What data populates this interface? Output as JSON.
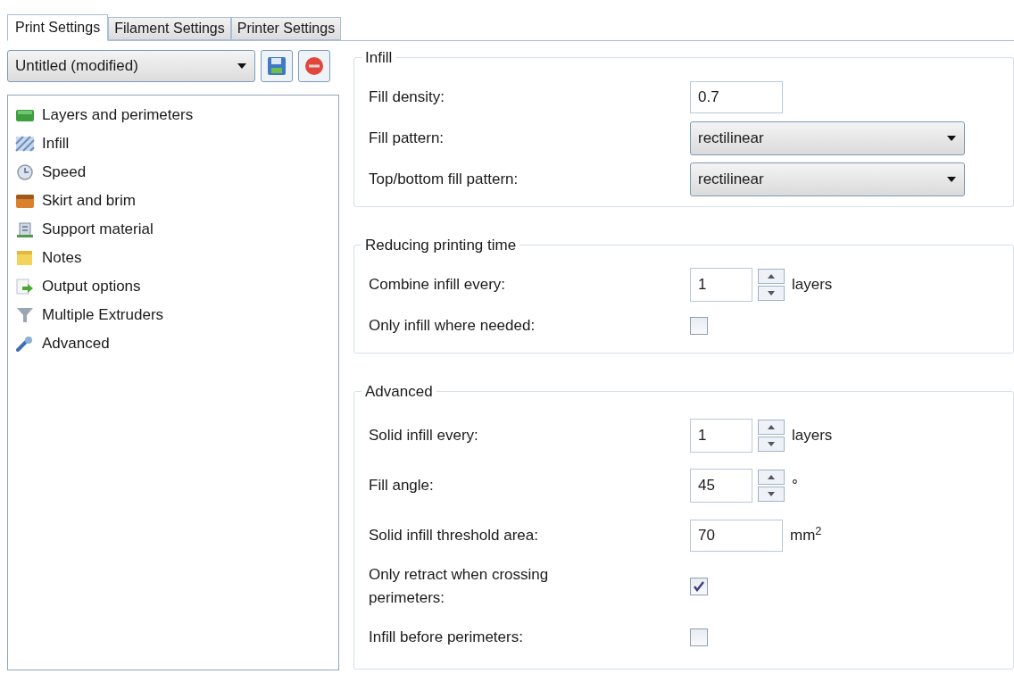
{
  "tabs": [
    {
      "label": "Print Settings",
      "selected": true
    },
    {
      "label": "Filament Settings",
      "selected": false
    },
    {
      "label": "Printer Settings",
      "selected": false
    }
  ],
  "preset": {
    "value": "Untitled (modified)"
  },
  "sidebar": {
    "items": [
      {
        "label": "Layers and perimeters",
        "selected": false
      },
      {
        "label": "Infill",
        "selected": false
      },
      {
        "label": "Speed",
        "selected": false
      },
      {
        "label": "Skirt and brim",
        "selected": false
      },
      {
        "label": "Support material",
        "selected": false
      },
      {
        "label": "Notes",
        "selected": false
      },
      {
        "label": "Output options",
        "selected": false
      },
      {
        "label": "Multiple Extruders",
        "selected": false
      },
      {
        "label": "Advanced",
        "selected": false
      }
    ]
  },
  "groups": [
    {
      "title": "Infill",
      "rows": [
        {
          "kind": "text",
          "label": "Fill density:",
          "value": "0.7"
        },
        {
          "kind": "select",
          "label": "Fill pattern:",
          "value": "rectilinear"
        },
        {
          "kind": "select",
          "label": "Top/bottom fill pattern:",
          "value": "rectilinear"
        }
      ]
    },
    {
      "title": "Reducing printing time",
      "rows": [
        {
          "kind": "spin",
          "label": "Combine infill every:",
          "value": "1",
          "unit": "layers"
        },
        {
          "kind": "checkbox",
          "label": "Only infill where needed:",
          "checked": false
        }
      ]
    },
    {
      "title": "Advanced",
      "rows": [
        {
          "kind": "spin",
          "label": "Solid infill every:",
          "value": "1",
          "unit": "layers"
        },
        {
          "kind": "spin",
          "label": "Fill angle:",
          "value": "45",
          "unit": "°"
        },
        {
          "kind": "text",
          "label": "Solid infill threshold area:",
          "value": "70",
          "unit": "mm$^{2}$"
        },
        {
          "kind": "checkbox",
          "label": "Only retract when crossing perimeters:",
          "checked": true
        },
        {
          "kind": "checkbox",
          "label": "Infill before perimeters:",
          "checked": false
        }
      ]
    }
  ]
}
